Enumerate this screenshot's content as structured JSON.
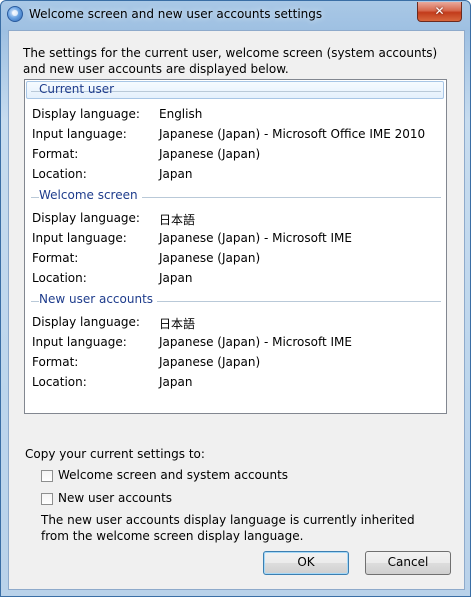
{
  "window": {
    "title": "Welcome screen and new user accounts settings",
    "close_glyph": "✕"
  },
  "intro_text": "The settings for the current user, welcome screen (system accounts) and new user accounts are displayed below.",
  "sections": {
    "current_user": {
      "header": "Current user",
      "rows": [
        {
          "label": "Display language:",
          "value": "English"
        },
        {
          "label": "Input language:",
          "value": "Japanese (Japan) - Microsoft Office IME 2010"
        },
        {
          "label": "Format:",
          "value": "Japanese (Japan)"
        },
        {
          "label": "Location:",
          "value": "Japan"
        }
      ]
    },
    "welcome_screen": {
      "header": "Welcome screen",
      "rows": [
        {
          "label": "Display language:",
          "value": "日本語"
        },
        {
          "label": "Input language:",
          "value": "Japanese (Japan) - Microsoft IME"
        },
        {
          "label": "Format:",
          "value": "Japanese (Japan)"
        },
        {
          "label": "Location:",
          "value": "Japan"
        }
      ]
    },
    "new_user_accounts": {
      "header": "New user accounts",
      "rows": [
        {
          "label": "Display language:",
          "value": "日本語"
        },
        {
          "label": "Input language:",
          "value": "Japanese (Japan) - Microsoft IME"
        },
        {
          "label": "Format:",
          "value": "Japanese (Japan)"
        },
        {
          "label": "Location:",
          "value": "Japan"
        }
      ]
    }
  },
  "copy_settings": {
    "label": "Copy your current settings to:",
    "welcome_checkbox": {
      "label": "Welcome screen and system accounts",
      "checked": false
    },
    "new_user_checkbox": {
      "label": "New user accounts",
      "checked": false
    },
    "note": "The new user accounts display language is currently inherited from the welcome screen display language."
  },
  "buttons": {
    "ok": "OK",
    "cancel": "Cancel"
  },
  "colors": {
    "section_header": "#1e3c8c",
    "window_frame": "#3a6ea5",
    "close_button": "#c23b1b"
  }
}
